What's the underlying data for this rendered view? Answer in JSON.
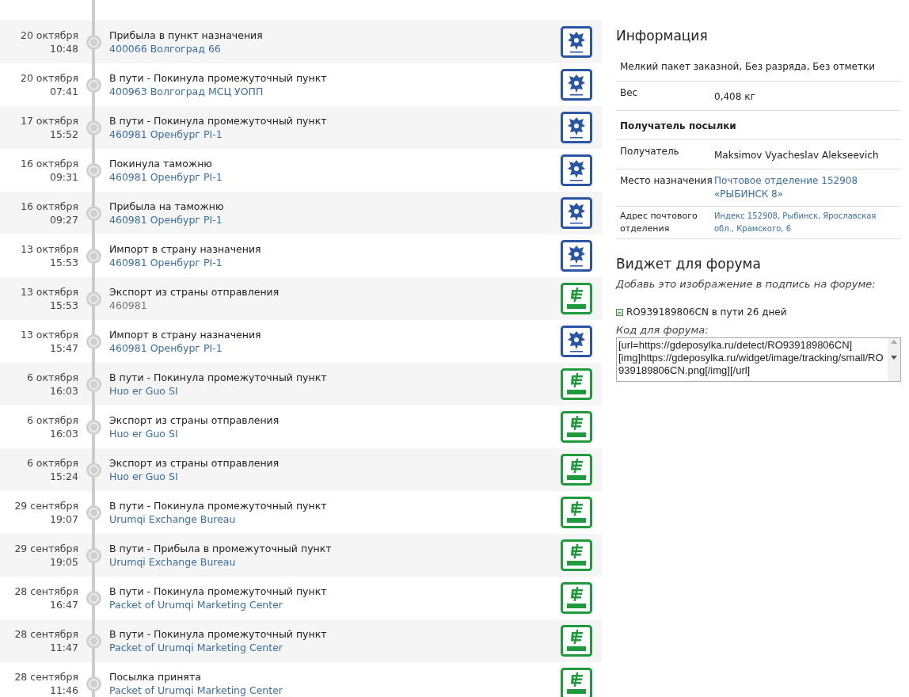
{
  "events": [
    {
      "date": "20 октября",
      "time": "10:48",
      "status": "Прибыла в пункт назначения",
      "location": "400066 Волгоград 66",
      "location_link": true,
      "kind": "russian_post"
    },
    {
      "date": "20 октября",
      "time": "07:41",
      "status": "В пути - Покинула промежуточный пункт",
      "location": "400963 Волгоград МСЦ УОПП",
      "location_link": true,
      "kind": "russian_post"
    },
    {
      "date": "17 октября",
      "time": "15:52",
      "status": "В пути - Покинула промежуточный пункт",
      "location": "460981 Оренбург PI-1",
      "location_link": true,
      "kind": "russian_post"
    },
    {
      "date": "16 октября",
      "time": "09:31",
      "status": "Покинула таможню",
      "location": "460981 Оренбург PI-1",
      "location_link": true,
      "kind": "russian_post"
    },
    {
      "date": "16 октября",
      "time": "09:27",
      "status": "Прибыла на таможню",
      "location": "460981 Оренбург PI-1",
      "location_link": true,
      "kind": "russian_post"
    },
    {
      "date": "13 октября",
      "time": "15:53",
      "status": "Импорт в страну назначения",
      "location": "460981 Оренбург PI-1",
      "location_link": true,
      "kind": "russian_post"
    },
    {
      "date": "13 октября",
      "time": "15:53",
      "status": "Экспорт из страны отправления",
      "location": "460981",
      "location_link": false,
      "kind": "china_post"
    },
    {
      "date": "13 октября",
      "time": "15:47",
      "status": "Импорт в страну назначения",
      "location": "460981 Оренбург PI-1",
      "location_link": true,
      "kind": "russian_post"
    },
    {
      "date": "6 октября",
      "time": "16:03",
      "status": "В пути - Покинула промежуточный пункт",
      "location": "Huo er Guo SI",
      "location_link": true,
      "kind": "china_post"
    },
    {
      "date": "6 октября",
      "time": "16:03",
      "status": "Экспорт из страны отправления",
      "location": "Huo er Guo SI",
      "location_link": true,
      "kind": "china_post"
    },
    {
      "date": "6 октября",
      "time": "15:24",
      "status": "Экспорт из страны отправления",
      "location": "Huo er Guo SI",
      "location_link": true,
      "kind": "china_post"
    },
    {
      "date": "29 сентября",
      "time": "19:07",
      "status": "В пути - Покинула промежуточный пункт",
      "location": "Urumqi Exchange Bureau",
      "location_link": true,
      "kind": "china_post"
    },
    {
      "date": "29 сентября",
      "time": "19:05",
      "status": "В пути - Прибыла в промежуточный пункт",
      "location": "Urumqi Exchange Bureau",
      "location_link": true,
      "kind": "china_post"
    },
    {
      "date": "28 сентября",
      "time": "16:47",
      "status": "В пути - Покинула промежуточный пункт",
      "location": "Packet of Urumqi Marketing Center",
      "location_link": true,
      "kind": "china_post"
    },
    {
      "date": "28 сентября",
      "time": "11:47",
      "status": "В пути - Покинула промежуточный пункт",
      "location": "Packet of Urumqi Marketing Center",
      "location_link": true,
      "kind": "china_post"
    },
    {
      "date": "28 сентября",
      "time": "11:46",
      "status": "Посылка принята",
      "location": "Packet of Urumqi Marketing Center",
      "location_link": true,
      "kind": "china_post"
    }
  ],
  "info": {
    "title": "Информация",
    "rows": [
      {
        "kind": "full",
        "text": "Мелкий пакет заказной, Без разряда, Без отметки"
      },
      {
        "kind": "pair",
        "label": "Вес",
        "value": "0,408 кг",
        "link": false
      },
      {
        "kind": "heading",
        "text": "Получатель посылки"
      },
      {
        "kind": "pair",
        "label": "Получатель",
        "value": "Maksimov Vyacheslav Alekseevich",
        "link": false
      },
      {
        "kind": "pair",
        "label": "Место назначения",
        "value": "Почтовое отделение 152908 «РЫБИНСК 8»",
        "link": true
      },
      {
        "kind": "pair_small",
        "label": "Адрес почтового отделения",
        "value": "Индекс 152908, Рыбинск, Ярославская обл., Крамского, 6",
        "link": true
      }
    ]
  },
  "widget": {
    "title": "Виджет для форума",
    "hint": "Добавь это изображение в подпись на форуме:",
    "image_text": "RO939189806CN в пути 26 дней",
    "code_label": "Код для форума:",
    "code": "[url=https://gdeposylka.ru/detect/RO939189806CN][img]https://gdeposylka.ru/widget/image/tracking/small/RO939189806CN.png[/img][/url]"
  }
}
